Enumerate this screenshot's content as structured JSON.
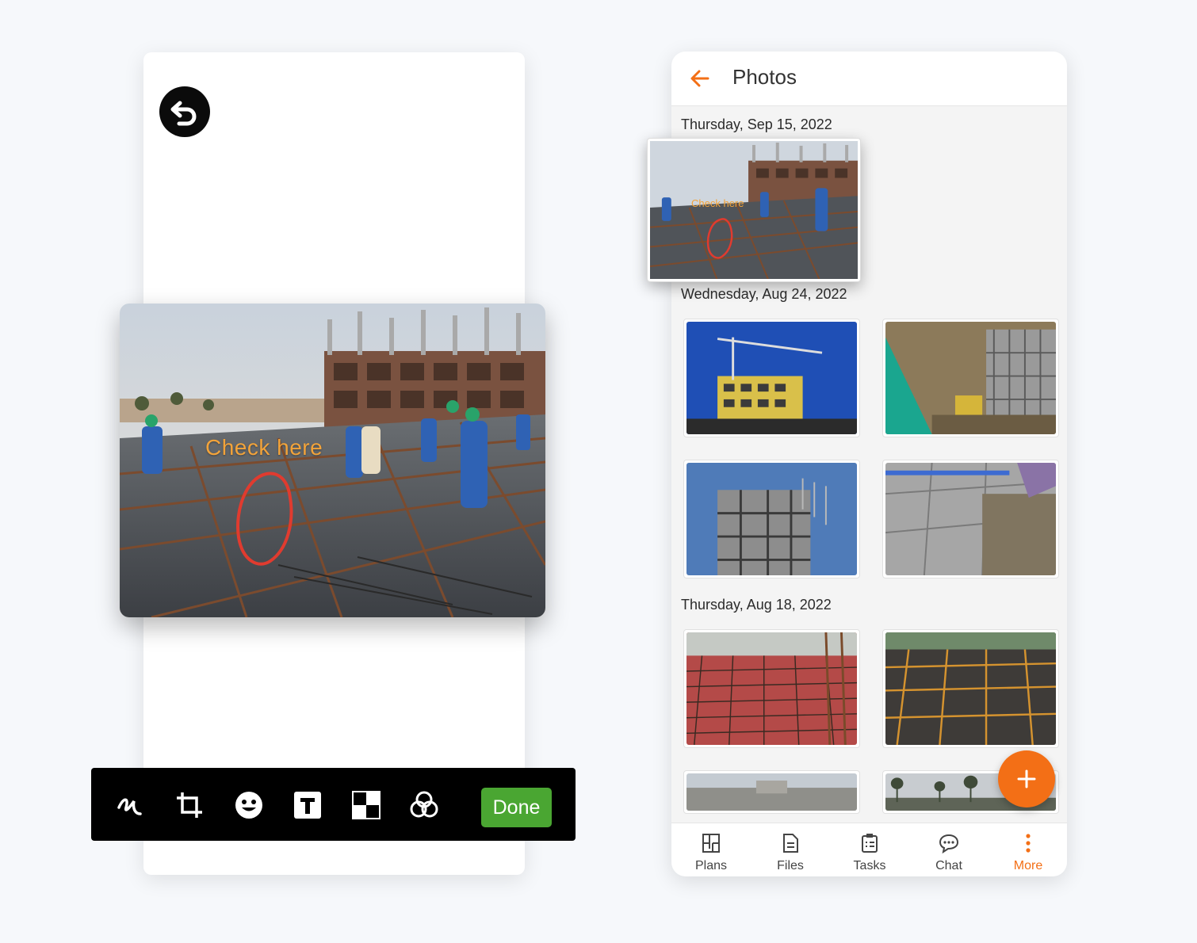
{
  "editor": {
    "annotation_text": "Check here",
    "toolbar": {
      "tools": [
        "draw-icon",
        "crop-icon",
        "emoji-icon",
        "text-icon",
        "blur-icon",
        "filter-icon"
      ],
      "done_label": "Done",
      "done_color": "#4aa632"
    }
  },
  "photos_app": {
    "title": "Photos",
    "accent_color": "#f36f16",
    "sections": [
      {
        "date": "Thursday, Sep 15, 2022",
        "photos": [
          "rebar-site-annotated"
        ]
      },
      {
        "date": "Wednesday, Aug 24, 2022",
        "photos": [
          "crane-building",
          "excavation-site",
          "concrete-frame",
          "tile-laying"
        ]
      },
      {
        "date": "Thursday, Aug 18, 2022",
        "photos": [
          "red-rebar-slab",
          "rebar-grid-slab",
          "site-wall",
          "palm-trees-site"
        ]
      }
    ],
    "floating_photo_annotation": "Check here",
    "fab_icon": "plus-icon",
    "bottom_nav": [
      {
        "label": "Plans",
        "icon": "plans-icon"
      },
      {
        "label": "Files",
        "icon": "files-icon"
      },
      {
        "label": "Tasks",
        "icon": "tasks-icon"
      },
      {
        "label": "Chat",
        "icon": "chat-icon"
      },
      {
        "label": "More",
        "icon": "more-icon",
        "active": true
      }
    ]
  }
}
